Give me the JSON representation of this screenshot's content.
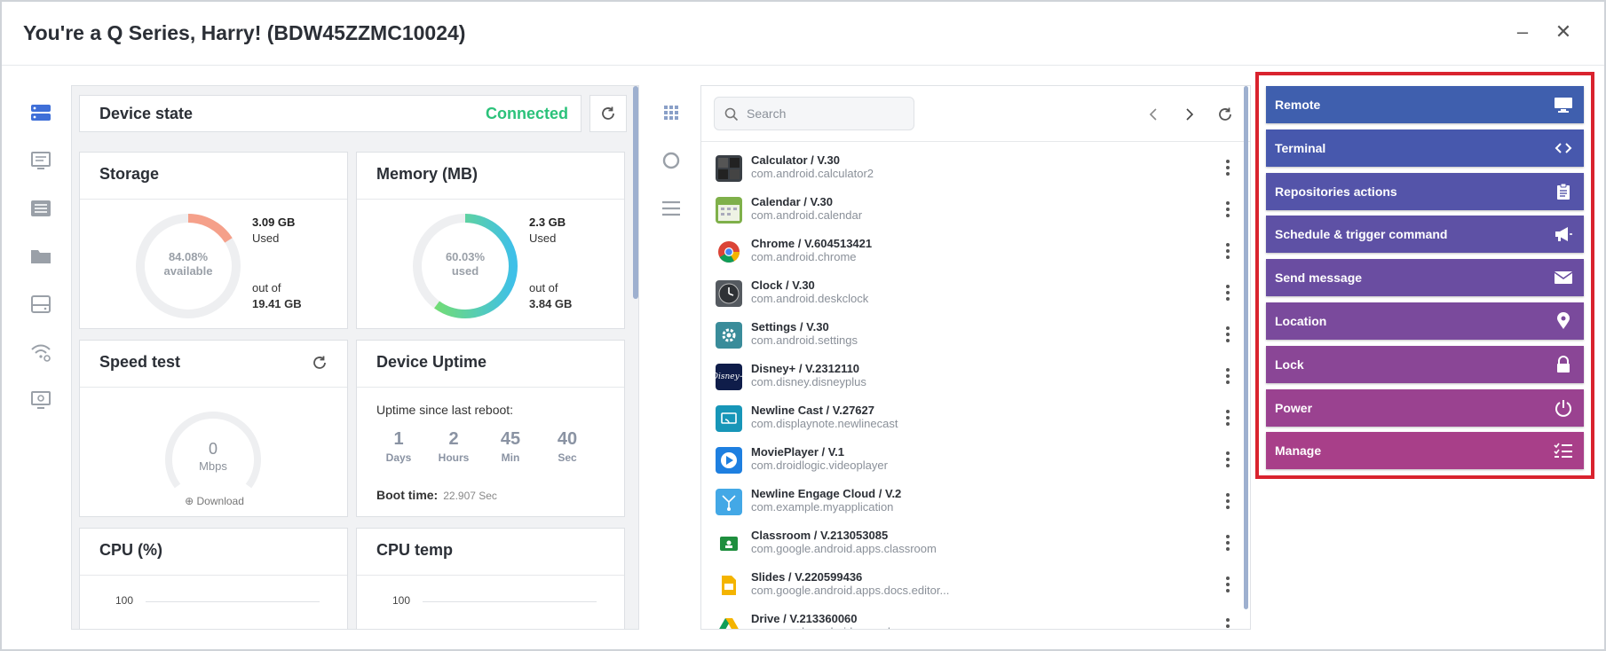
{
  "window": {
    "title": "You're a Q Series, Harry! (BDW45ZZMC10024)",
    "minimize_glyph": "–",
    "close_glyph": "✕"
  },
  "left_nav": [
    "server-icon",
    "message-board-icon",
    "list-icon",
    "folder-icon",
    "storage-drive-icon",
    "wifi-settings-icon",
    "monitor-settings-icon"
  ],
  "device": {
    "state": {
      "label": "Device state",
      "value": "Connected",
      "value_color": "#2bc27a"
    },
    "storage": {
      "title": "Storage",
      "center_pct": "84.08%",
      "center_label": "available",
      "used_value": "3.09 GB",
      "used_label": "Used",
      "total_label": "out of",
      "total_value": "19.41 GB",
      "fraction_used": 0.1592
    },
    "memory": {
      "title": "Memory (MB)",
      "center_pct": "60.03%",
      "center_label": "used",
      "used_value": "2.3 GB",
      "used_label": "Used",
      "total_label": "out of",
      "total_value": "3.84 GB",
      "fraction_used": 0.6003
    },
    "speed": {
      "title": "Speed test",
      "value": "0",
      "unit": "Mbps",
      "download_label": "Download"
    },
    "uptime": {
      "title": "Device Uptime",
      "label": "Uptime since last reboot:",
      "days": "1",
      "days_label": "Days",
      "hours": "2",
      "hours_label": "Hours",
      "min": "45",
      "min_label": "Min",
      "sec": "40",
      "sec_label": "Sec",
      "boot_label": "Boot time:",
      "boot_value": "22.907 Sec"
    },
    "cpu": {
      "title": "CPU (%)",
      "axis_top": "100"
    },
    "temp": {
      "title": "CPU temp",
      "axis_top": "100"
    }
  },
  "mid_toolbar": [
    "grid-icon",
    "circle-refresh-icon",
    "menu-lines-icon"
  ],
  "apps": {
    "search_placeholder": "Search",
    "items": [
      {
        "name": "Calculator / V.30",
        "pkg": "com.android.calculator2",
        "icon": "calculator-icon",
        "color": "#3a3f45"
      },
      {
        "name": "Calendar / V.30",
        "pkg": "com.android.calendar",
        "icon": "calendar-icon",
        "color": "#7fb04a"
      },
      {
        "name": "Chrome / V.604513421",
        "pkg": "com.android.chrome",
        "icon": "chrome-icon",
        "color": "#ffffff"
      },
      {
        "name": "Clock / V.30",
        "pkg": "com.android.deskclock",
        "icon": "clock-icon",
        "color": "#555a60"
      },
      {
        "name": "Settings / V.30",
        "pkg": "com.android.settings",
        "icon": "settings-gear-icon",
        "color": "#3a8c9a"
      },
      {
        "name": "Disney+ / V.2312110",
        "pkg": "com.disney.disneyplus",
        "icon": "disney-plus-icon",
        "color": "#0f1d4a"
      },
      {
        "name": "Newline Cast / V.27627",
        "pkg": "com.displaynote.newlinecast",
        "icon": "cast-icon",
        "color": "#1796b8"
      },
      {
        "name": "MoviePlayer / V.1",
        "pkg": "com.droidlogic.videoplayer",
        "icon": "play-icon",
        "color": "#1e7fe0"
      },
      {
        "name": "Newline Engage Cloud / V.2",
        "pkg": "com.example.myapplication",
        "icon": "engage-cloud-icon",
        "color": "#43a8e6"
      },
      {
        "name": "Classroom / V.213053085",
        "pkg": "com.google.android.apps.classroom",
        "icon": "classroom-icon",
        "color": "#1e8e3e"
      },
      {
        "name": "Slides / V.220599436",
        "pkg": "com.google.android.apps.docs.editor...",
        "icon": "slides-icon",
        "color": "#f4b400"
      },
      {
        "name": "Drive / V.213360060",
        "pkg": "com.google.android.apps.docs",
        "icon": "drive-icon",
        "color": "#0f9d58"
      }
    ]
  },
  "actions": {
    "frame_color": "#d9232e",
    "items": [
      {
        "label": "Remote",
        "icon": "monitor-icon",
        "color": "#3f5fae"
      },
      {
        "label": "Terminal",
        "icon": "code-icon",
        "color": "#4758ad"
      },
      {
        "label": "Repositories actions",
        "icon": "clipboard-icon",
        "color": "#5454a9"
      },
      {
        "label": "Schedule & trigger command",
        "icon": "megaphone-icon",
        "color": "#5e51a5"
      },
      {
        "label": "Send message",
        "icon": "envelope-icon",
        "color": "#6a4da1"
      },
      {
        "label": "Location",
        "icon": "location-pin-icon",
        "color": "#7a4a9c"
      },
      {
        "label": "Lock",
        "icon": "lock-icon",
        "color": "#8a4696"
      },
      {
        "label": "Power",
        "icon": "power-icon",
        "color": "#9a4290"
      },
      {
        "label": "Manage",
        "icon": "checklist-icon",
        "color": "#a83f89"
      }
    ]
  }
}
